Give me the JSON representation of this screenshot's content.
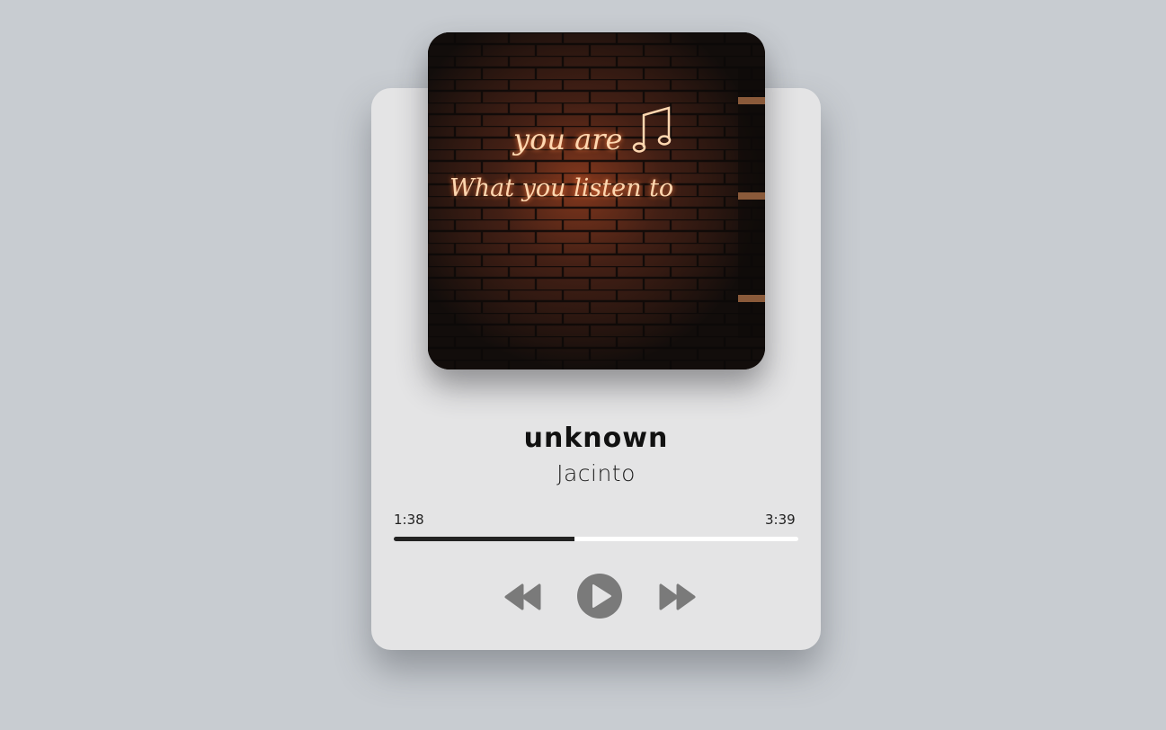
{
  "player": {
    "title": "unknown",
    "artist": "Jacinto",
    "current_time": "1:38",
    "total_time": "3:39",
    "progress_fraction": 0.447,
    "artwork": {
      "neon_line_1": "you are",
      "neon_line_2": "What you listen to"
    }
  },
  "controls": {
    "previous_icon": "rewind-icon",
    "play_icon": "play-icon",
    "next_icon": "fast-forward-icon"
  },
  "colors": {
    "background": "#c8ccd1",
    "card": "#e4e4e5",
    "progress_track": "#ffffff",
    "progress_fill": "#222222",
    "controls": "#7a7a7a",
    "neon": "#ffcf9e"
  }
}
